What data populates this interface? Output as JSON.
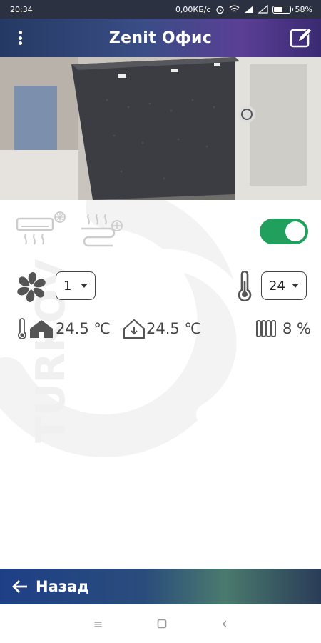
{
  "status_bar": {
    "time": "20:34",
    "network_speed": "0,00КБ/с",
    "battery_percent": "58%",
    "battery_level": 0.58
  },
  "header": {
    "title": "Zenit Офис",
    "menu_icon": "more-vert-icon",
    "edit_icon": "edit-icon"
  },
  "controls": {
    "power_on": true,
    "fan_speed": "1",
    "target_temp": "24"
  },
  "readings": {
    "indoor_temp": "24.5 ℃",
    "outdoor_temp": "24.5 ℃",
    "radiator_level": "8 %"
  },
  "footer": {
    "back_label": "Назад"
  },
  "nav": {
    "menu_glyph": "≡",
    "back_glyph": "‹"
  },
  "colors": {
    "toggle_on": "#21a05d",
    "header_gradient_start": "#243a63",
    "header_gradient_end": "#5a3f95"
  }
}
